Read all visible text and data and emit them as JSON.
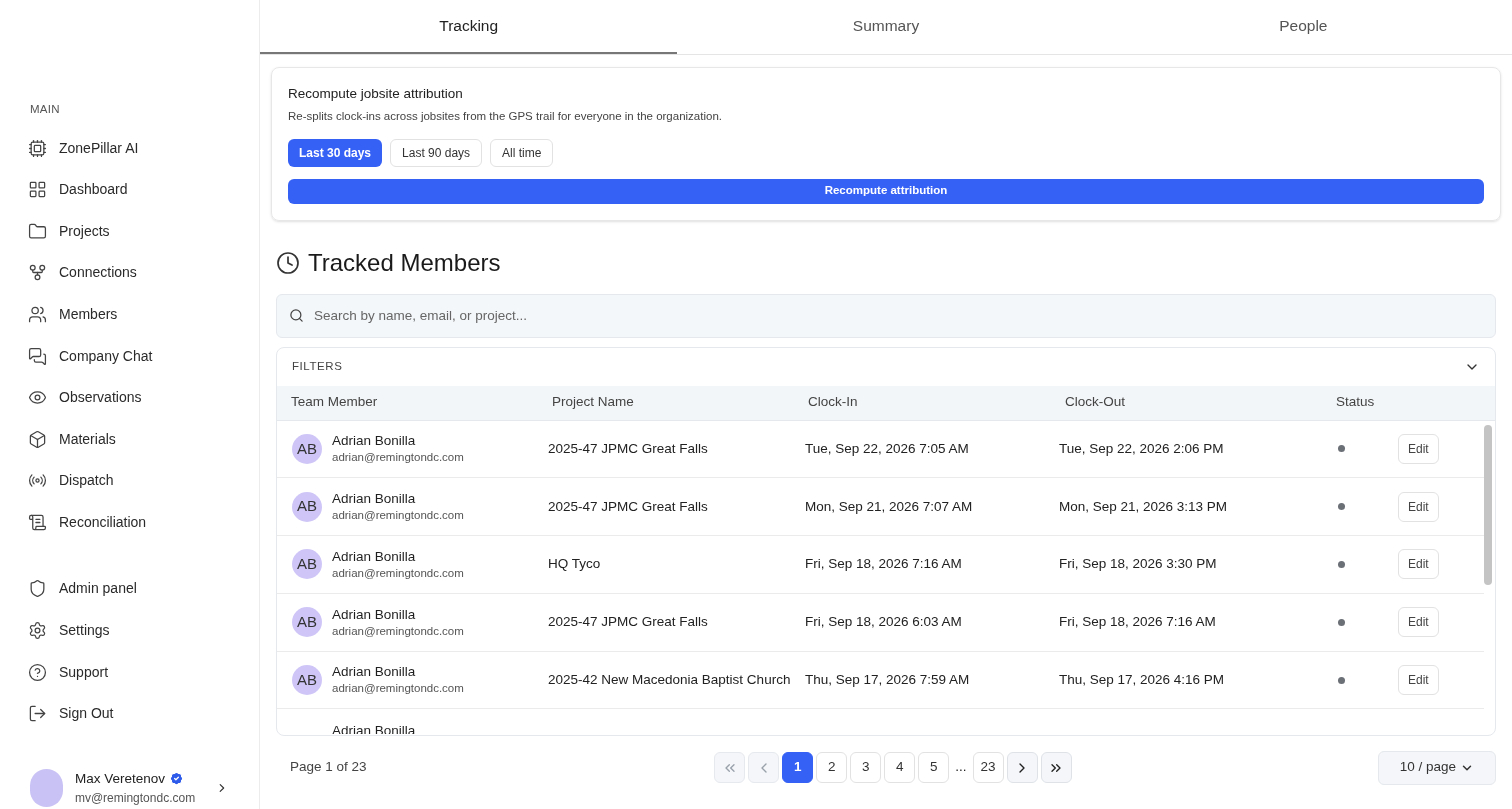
{
  "sidebar": {
    "section_label": "MAIN",
    "items": [
      {
        "label": "ZonePillar AI"
      },
      {
        "label": "Dashboard"
      },
      {
        "label": "Projects"
      },
      {
        "label": "Connections"
      },
      {
        "label": "Members"
      },
      {
        "label": "Company Chat"
      },
      {
        "label": "Observations"
      },
      {
        "label": "Materials"
      },
      {
        "label": "Dispatch"
      },
      {
        "label": "Reconciliation"
      }
    ],
    "secondary_items": [
      {
        "label": "Admin panel"
      },
      {
        "label": "Settings"
      },
      {
        "label": "Support"
      },
      {
        "label": "Sign Out"
      }
    ],
    "user": {
      "name": "Max Veretenov",
      "email": "mv@remingtondc.com",
      "verified": true
    }
  },
  "tabs": [
    {
      "label": "Tracking",
      "selected": true
    },
    {
      "label": "Summary",
      "selected": false
    },
    {
      "label": "People",
      "selected": false
    }
  ],
  "recompute": {
    "title": "Recompute jobsite attribution",
    "description": "Re-splits clock-ins across jobsites from the GPS trail for everyone in the organization.",
    "ranges": [
      {
        "label": "Last 30 days",
        "selected": true
      },
      {
        "label": "Last 90 days",
        "selected": false
      },
      {
        "label": "All time",
        "selected": false
      }
    ],
    "button": "Recompute attribution"
  },
  "tracked": {
    "title": "Tracked Members",
    "search": {
      "placeholder": "Search by name, email, or project..."
    },
    "filters_label": "FILTERS",
    "columns": [
      "Team Member",
      "Project Name",
      "Clock-In",
      "Clock-Out",
      "Status"
    ],
    "rows": [
      {
        "initials": "AB",
        "name": "Adrian Bonilla",
        "email": "adrian@remingtondc.com",
        "project": "2025-47 JPMC Great Falls",
        "clock_in": "Tue, Sep 22, 2026 7:05 AM",
        "clock_out": "Tue, Sep 22, 2026 2:06 PM",
        "action": "Edit"
      },
      {
        "initials": "AB",
        "name": "Adrian Bonilla",
        "email": "adrian@remingtondc.com",
        "project": "2025-47 JPMC Great Falls",
        "clock_in": "Mon, Sep 21, 2026 7:07 AM",
        "clock_out": "Mon, Sep 21, 2026 3:13 PM",
        "action": "Edit"
      },
      {
        "initials": "AB",
        "name": "Adrian Bonilla",
        "email": "adrian@remingtondc.com",
        "project": "HQ Tyco",
        "clock_in": "Fri, Sep 18, 2026 7:16 AM",
        "clock_out": "Fri, Sep 18, 2026 3:30 PM",
        "action": "Edit"
      },
      {
        "initials": "AB",
        "name": "Adrian Bonilla",
        "email": "adrian@remingtondc.com",
        "project": "2025-47 JPMC Great Falls",
        "clock_in": "Fri, Sep 18, 2026 6:03 AM",
        "clock_out": "Fri, Sep 18, 2026 7:16 AM",
        "action": "Edit"
      },
      {
        "initials": "AB",
        "name": "Adrian Bonilla",
        "email": "adrian@remingtondc.com",
        "project": "2025-42 New Macedonia Baptist Church",
        "clock_in": "Thu, Sep 17, 2026 7:59 AM",
        "clock_out": "Thu, Sep 17, 2026 4:16 PM",
        "action": "Edit"
      },
      {
        "name": "Adrian Bonilla"
      }
    ]
  },
  "pagination": {
    "summary": "Page 1 of 23",
    "pages": [
      {
        "label": "1",
        "selected": true
      },
      {
        "label": "2",
        "selected": false
      },
      {
        "label": "3",
        "selected": false
      },
      {
        "label": "4",
        "selected": false
      },
      {
        "label": "5",
        "selected": false
      },
      {
        "label": "...",
        "kind": "gap"
      },
      {
        "label": "23",
        "selected": false
      }
    ],
    "first_disabled": true,
    "prev_disabled": true,
    "next_disabled": false,
    "last_disabled": false,
    "page_size": "10 / page"
  }
}
